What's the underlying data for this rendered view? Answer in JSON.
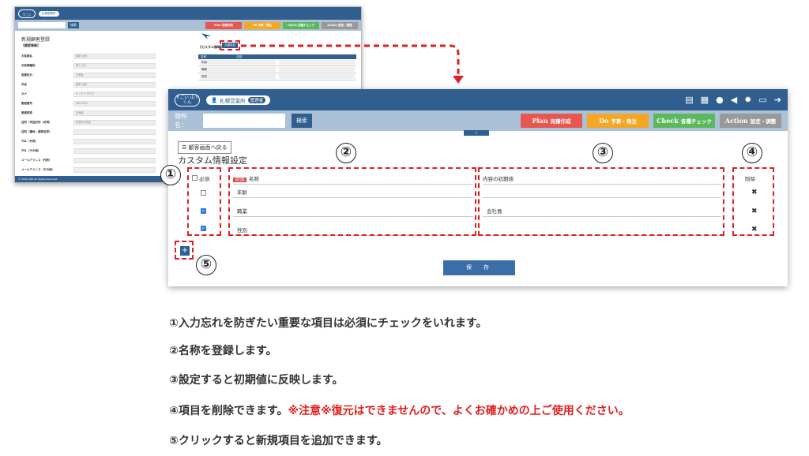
{
  "bg": {
    "office": "札幌営業所",
    "search_btn": "検索",
    "title": "新規顧客登録",
    "section": "【顧客情報】",
    "custom_btn": "共通項目",
    "custom_title": "【カスタム情報】",
    "footer": "© STAR LINK All Rights Reserved.",
    "plan": "Plan 見積作成",
    "do": "Do 予算・発注",
    "check": "Check 各種チェック",
    "action": "Action 設定・調整",
    "rows": [
      {
        "label": "お客様名",
        "value": "建築 太郎"
      },
      {
        "label": "お客様種別",
        "value": "個人 法人"
      },
      {
        "label": "客層区分",
        "value": "引渡後"
      },
      {
        "label": "氏名",
        "value": "建築 太郎"
      },
      {
        "label": "カナ",
        "value": "ケンチク タロウ"
      },
      {
        "label": "郵便番号",
        "value": "060 0022"
      },
      {
        "label": "都道府県",
        "value": "北海道"
      },
      {
        "label": "住所（市区町村・町域）",
        "value": "札幌市中央区"
      },
      {
        "label": "住所（番地・建物名等）",
        "value": ""
      },
      {
        "label": "TEL（代表）",
        "value": ""
      },
      {
        "label": "TEL（その他）",
        "value": ""
      },
      {
        "label": "メールアドレス（代表）",
        "value": ""
      },
      {
        "label": "メールアドレス（その他）",
        "value": ""
      }
    ],
    "table_rows": [
      "年齢",
      "職業",
      "性別"
    ]
  },
  "main": {
    "logo": "すごい 山下くん",
    "office": "札幌営業所",
    "role": "管理者",
    "property_label": "物件名：",
    "search_btn": "検索",
    "plan_b": "Plan",
    "plan_t": "見積作成",
    "do_b": "Do",
    "do_t": "予算・発注",
    "check_b": "Check",
    "check_t": "各種チェック",
    "action_b": "Action",
    "action_t": "設定・調整",
    "back": "顧客画面へ戻る",
    "title": "カスタム情報設定",
    "col_required": "必須",
    "col_name": "名称",
    "col_default": "内容の初期値",
    "col_delete": "削除",
    "req_tag": "必須",
    "rows": [
      {
        "name": "年齢",
        "default": "",
        "checked": false
      },
      {
        "name": "職業",
        "default": "会社員",
        "checked": true
      },
      {
        "name": "性別",
        "default": "",
        "checked": true
      }
    ],
    "add": "+",
    "save": "保　存"
  },
  "numbers": [
    "①",
    "②",
    "③",
    "④",
    "⑤"
  ],
  "colors": {
    "accent": "#2f5e8f",
    "plan": "#e8574f",
    "do": "#f5a623",
    "check": "#5cb85c",
    "action": "#999999",
    "dash": "#e02020"
  },
  "explanations": [
    {
      "text": "①入力忘れを防ぎたい重要な項目は必須にチェックをいれます。",
      "red": ""
    },
    {
      "text": "②名称を登録します。",
      "red": ""
    },
    {
      "text": "③設定すると初期値に反映します。",
      "red": ""
    },
    {
      "text": "④項目を削除できます。",
      "red": "※注意※復元はできませんので、よくお確かめの上ご使用ください。"
    },
    {
      "text": "⑤クリックすると新規項目を追加できます。",
      "red": ""
    }
  ]
}
